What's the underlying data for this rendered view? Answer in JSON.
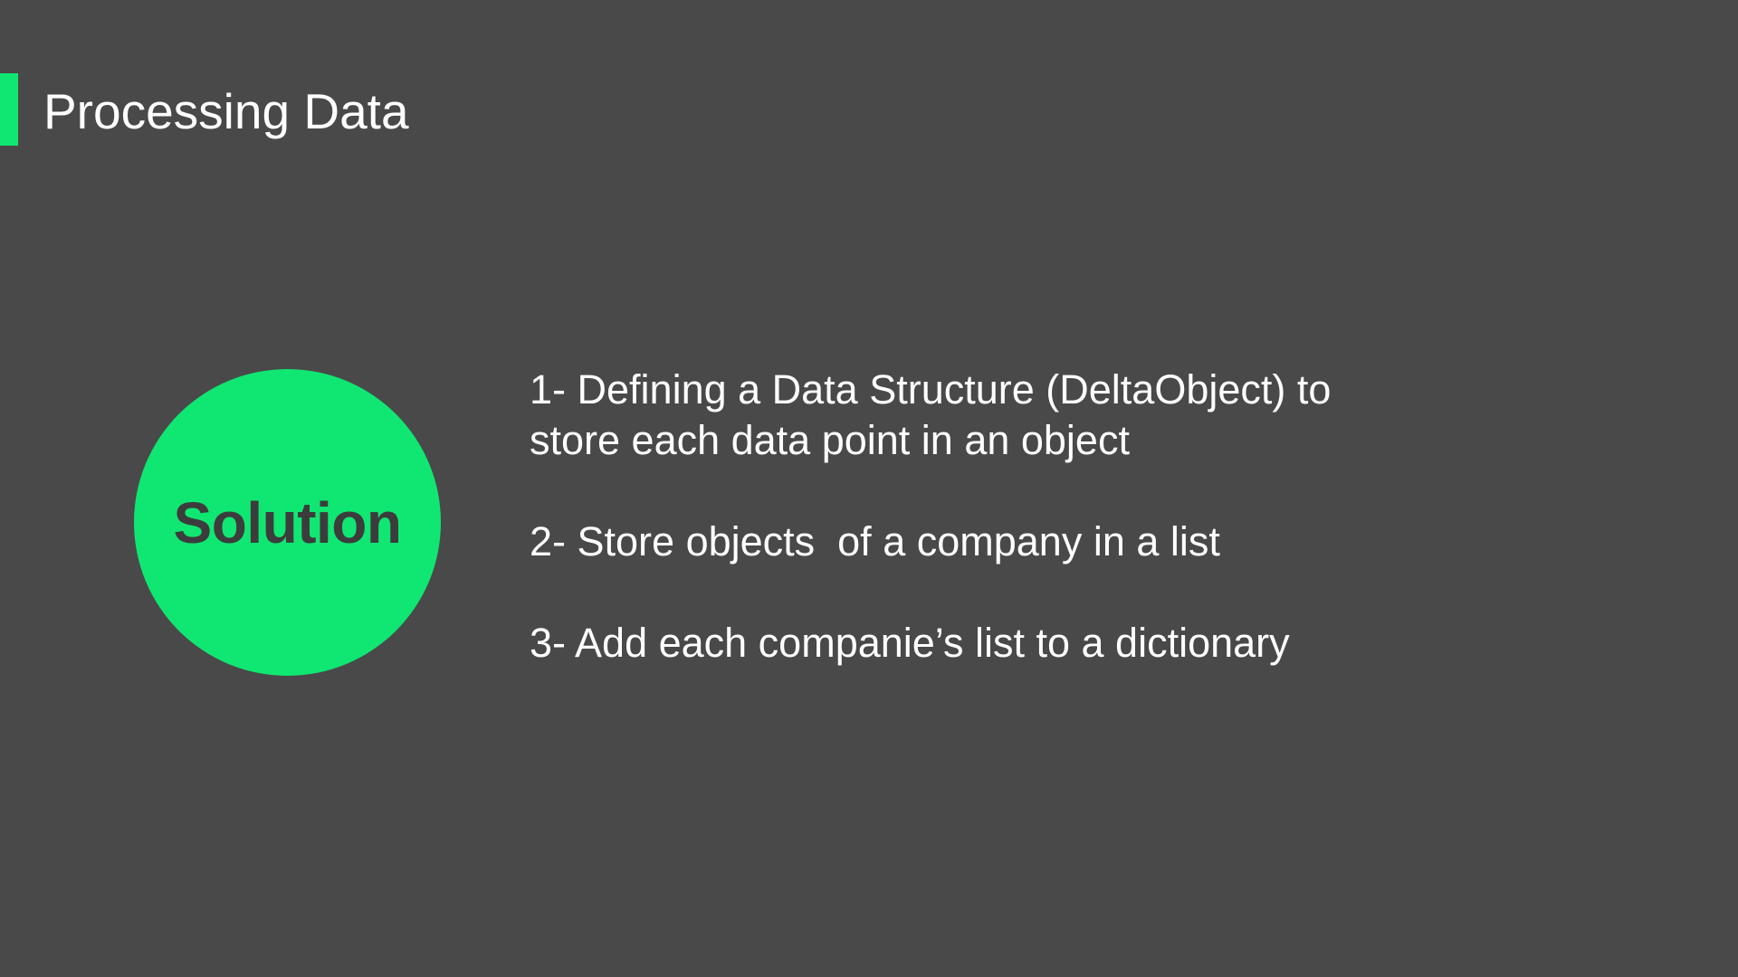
{
  "slide": {
    "title": "Processing Data",
    "accent_color": "#10e772",
    "background_color": "#494949"
  },
  "callout": {
    "label": "Solution"
  },
  "steps": [
    "1- Defining a Data Structure (DeltaObject) to\nstore each data point in an object",
    "2- Store objects  of a company in a list",
    "3- Add each companie’s list to a dictionary"
  ]
}
